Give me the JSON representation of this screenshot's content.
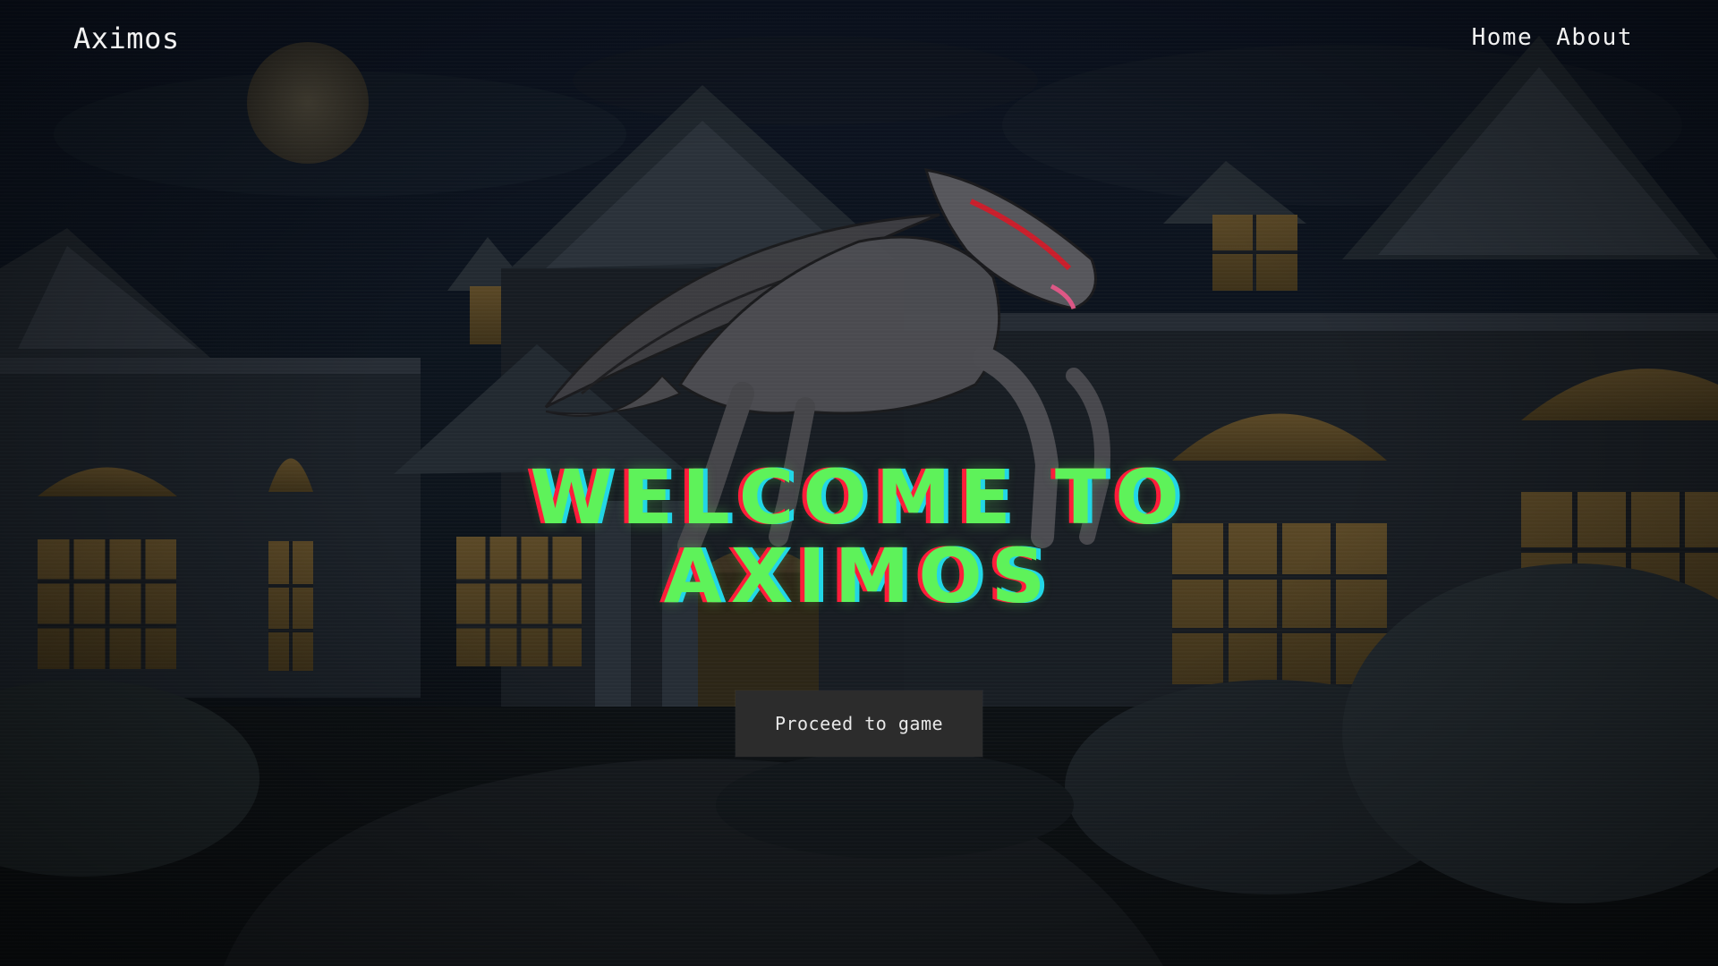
{
  "navbar": {
    "brand": "Aximos",
    "links": [
      "Home",
      "About"
    ]
  },
  "hero": {
    "title_line1": "WELCOME TO",
    "title_line2": "AXIMOS",
    "cta_label": "Proceed to game"
  },
  "colors": {
    "title_green": "#5ef25a",
    "glitch_red": "#ff1c3a",
    "glitch_cyan": "#22d6e6",
    "button_bg": "#2c2c2c"
  },
  "icons": {
    "background": "night-mansion-background",
    "creature": "winged-creature-illustration",
    "moon": "moon-icon"
  }
}
